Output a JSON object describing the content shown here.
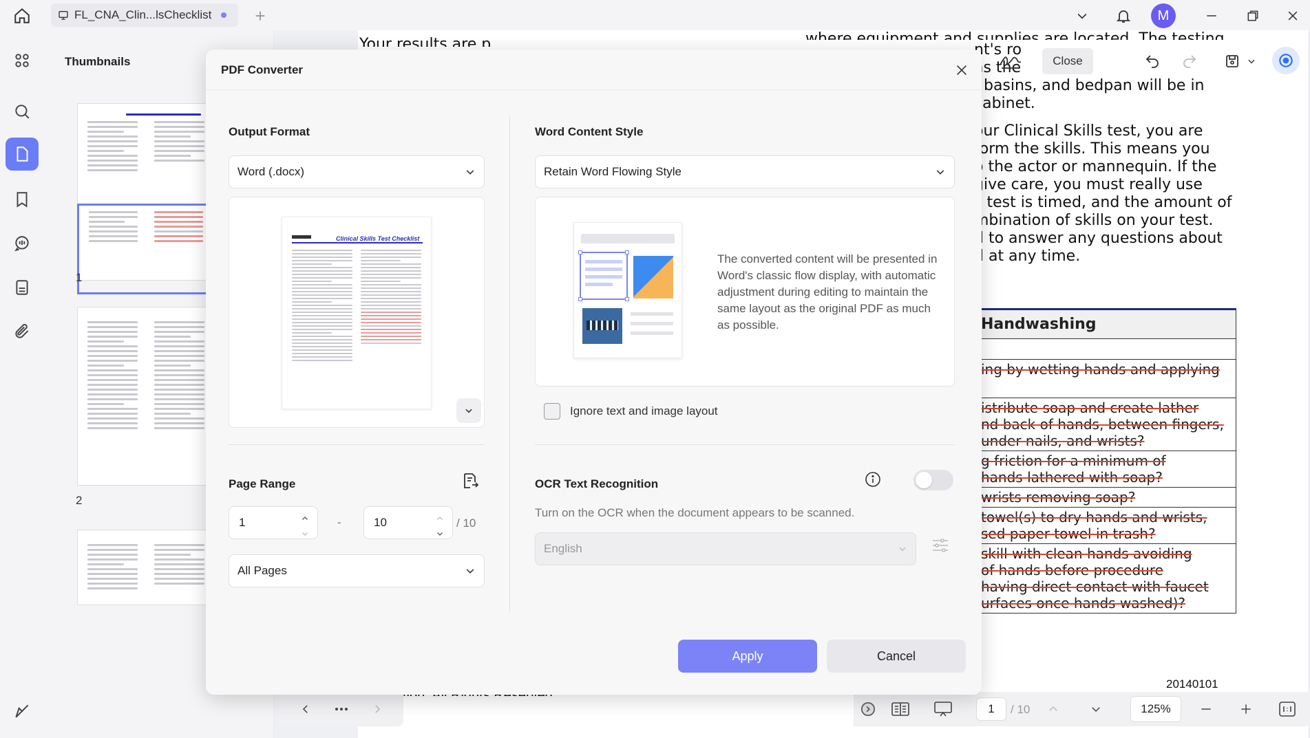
{
  "topbar": {
    "tab_title": "FL_CNA_Clin...lsChecklist",
    "avatar_letter": "M"
  },
  "thumbnails": {
    "title": "Thumbnails",
    "pages": [
      "1",
      "2"
    ]
  },
  "document": {
    "top_text": "where equipment and supplies are located. The testing",
    "top_left_text": "Your results are p",
    "lines": [
      "nt's ro",
      "as the",
      ", basins, and bedpan will be in",
      "cabinet.",
      "",
      "our Clinical Skills test, you are",
      "form the skills. This means you",
      "o the actor or mannequin. If the",
      "give care, you must really use",
      "s test is timed, and the amount of",
      "mbination of skills on your test.",
      "d to answer any questions about",
      "d at any time."
    ],
    "table_header": "Handwashing",
    "table_rows": [
      [
        ""
      ],
      [
        "ing by wetting hands and applying"
      ],
      [
        "istribute soap and create lather",
        "nd back of hands, between fingers,",
        "under nails, and wrists?"
      ],
      [
        "g friction for a minimum of",
        "hands lathered with soap?"
      ],
      [
        "wrists removing soap?"
      ],
      [
        "towel(s) to dry hands and wrists,",
        "sed paper towel in trash?"
      ],
      [
        "skill with clean hands avoiding",
        "of hands before procedure",
        "having direct contact with faucet",
        "urfaces once hands washed)?"
      ]
    ],
    "footer_date": "20140101",
    "footer_copy": "tion. All Rights Reserved."
  },
  "right_toolbar": {
    "close_label": "Close"
  },
  "bottom_bar": {
    "current_page": "1",
    "page_total": "/ 10",
    "zoom": "125%"
  },
  "modal": {
    "title": "PDF Converter",
    "output_format": {
      "label": "Output Format",
      "value": "Word (.docx)",
      "preview_title": "Clinical Skills Test Checklist"
    },
    "word_style": {
      "label": "Word Content Style",
      "value": "Retain Word Flowing Style",
      "description": "The converted content will be presented in Word's classic flow display, with automatic adjustment during editing to maintain the same layout as the original PDF as much as possible."
    },
    "ignore_layout_label": "Ignore text and image layout",
    "page_range": {
      "label": "Page Range",
      "from": "1",
      "dash": "-",
      "to": "10",
      "total": "/ 10",
      "selection": "All Pages"
    },
    "ocr": {
      "label": "OCR Text Recognition",
      "description": "Turn on the OCR when the document appears to be scanned.",
      "language": "English",
      "enabled": false
    },
    "apply_label": "Apply",
    "cancel_label": "Cancel"
  },
  "colors": {
    "accent": "#6b7cf7",
    "apply": "#7b83f7",
    "avatar": "#6a5cf0",
    "strike": "#d9452c"
  }
}
